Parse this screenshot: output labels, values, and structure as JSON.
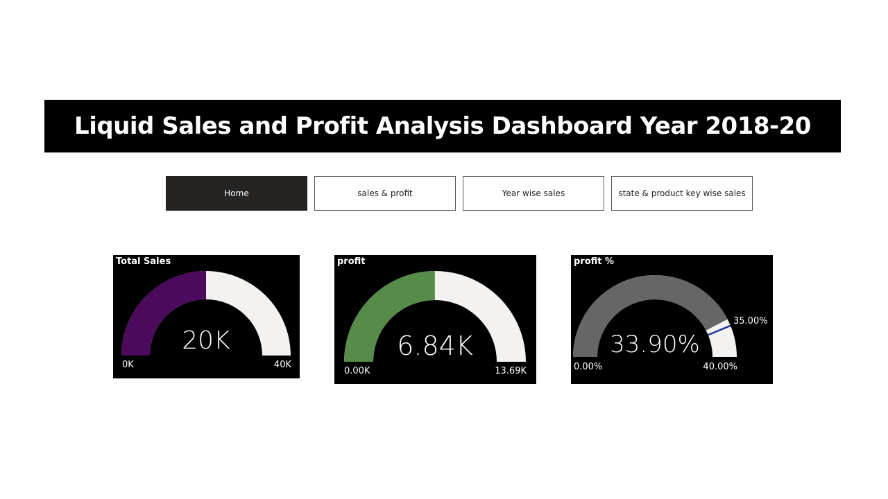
{
  "header": {
    "title": "Liquid Sales and Profit Analysis Dashboard Year 2018-20"
  },
  "nav": {
    "items": [
      {
        "label": "Home",
        "active": true
      },
      {
        "label": "sales & profit",
        "active": false
      },
      {
        "label": "Year wise sales",
        "active": false
      },
      {
        "label": "state & product key wise sales",
        "active": false
      }
    ]
  },
  "gauges": [
    {
      "title": "Total Sales",
      "value_label": "20K",
      "min_label": "0K",
      "max_label": "40K",
      "min": 0,
      "max": 40000,
      "value": 20000,
      "fill_color": "#4B0A5C",
      "track_color": "#F3F2F1"
    },
    {
      "title": "profit",
      "value_label": "6.84K",
      "min_label": "0.00K",
      "max_label": "13.69K",
      "min": 0,
      "max": 13690,
      "value": 6840,
      "fill_color": "#568B4A",
      "track_color": "#F3F2F1"
    },
    {
      "title": "profit %",
      "value_label": "33.90%",
      "min_label": "0.00%",
      "max_label": "40.00%",
      "target_label": "35.00%",
      "min": 0,
      "max": 40,
      "value": 33.9,
      "target": 35,
      "fill_color": "#666666",
      "track_color": "#F3F2F1",
      "target_color": "#1F2F9E"
    }
  ]
}
